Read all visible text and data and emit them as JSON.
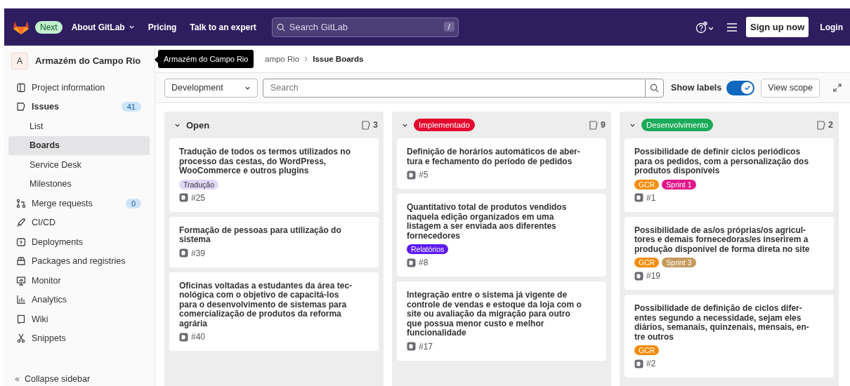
{
  "top_nav": {
    "badge": "Next",
    "links": [
      {
        "label": "About GitLab",
        "dropdown": true
      },
      {
        "label": "Pricing",
        "dropdown": false
      },
      {
        "label": "Talk to an expert",
        "dropdown": false
      }
    ],
    "search": {
      "placeholder": "Search GitLab",
      "shortcut": "/"
    },
    "signup": "Sign up now",
    "login": "Login"
  },
  "sidebar": {
    "project": {
      "avatar": "A",
      "name": "Armazém do Campo Rio"
    },
    "items": [
      {
        "label": "Project information",
        "selected": false
      },
      {
        "label": "Issues",
        "badge": "41",
        "selected": false,
        "children": [
          {
            "label": "List",
            "selected": false
          },
          {
            "label": "Boards",
            "selected": true
          },
          {
            "label": "Service Desk",
            "selected": false
          },
          {
            "label": "Milestones",
            "selected": false
          }
        ]
      },
      {
        "label": "Merge requests",
        "badge": "0",
        "selected": false
      },
      {
        "label": "CI/CD",
        "selected": false
      },
      {
        "label": "Deployments",
        "selected": false
      },
      {
        "label": "Packages and registries",
        "selected": false
      },
      {
        "label": "Monitor",
        "selected": false
      },
      {
        "label": "Analytics",
        "selected": false
      },
      {
        "label": "Wiki",
        "selected": false
      },
      {
        "label": "Snippets",
        "selected": false
      }
    ],
    "collapse": "Collapse sidebar"
  },
  "tooltip": "Armazém do Campo Rio",
  "breadcrumb": [
    "ampo Rio",
    "Issue Boards"
  ],
  "filter_bar": {
    "board": "Development",
    "search": {
      "placeholder": "Search"
    },
    "show_labels": {
      "label": "Show labels",
      "on": true
    },
    "view_scope": "View scope"
  },
  "board": {
    "lists": [
      {
        "title": "Open",
        "kind": "plain",
        "count": "3",
        "cards": [
          {
            "title": "Tradução de todos os termos utilizados no\nprocesso das cestas, do WordPress,\nWooCommerce e outros plugins",
            "labels": [
              {
                "text": "Tradução",
                "color": "#e1d8f9"
              }
            ],
            "number": "#25"
          },
          {
            "title": "Formação de pessoas para utilização do\nsistema",
            "number": "#39"
          },
          {
            "title": "Oficinas voltadas a estudantes da área tec-\nnológica com o objetivo de capacitá-los\npara o desenvolvimento de sistemas para\ncomercialização de produtos da reforma\nagrária",
            "number": "#40"
          }
        ]
      },
      {
        "title": "Implementado",
        "kind": "label",
        "color": "#e5092f",
        "count": "9",
        "cards": [
          {
            "title": "Definição de horários automáticos de aber-\ntura e fechamento do período de pedidos",
            "number": "#5"
          },
          {
            "title": "Quantitativo total de produtos vendidos\nnaquela edição organizados em uma\nlistagem a ser enviada aos diferentes\nfornecedores",
            "labels": [
              {
                "text": "Relatórios",
                "color": "#5c19f5"
              }
            ],
            "number": "#8"
          },
          {
            "title": "Integração entre o sistema já vigente de\ncontrole de vendas e estoque da loja com o\nsite ou avaliação da migração para outro\nque possua menor custo e melhor\nfuncionalidade",
            "number": "#17"
          }
        ]
      },
      {
        "title": "Desenvolvimento",
        "kind": "label",
        "color": "#1bab5a",
        "count": "2",
        "cards": [
          {
            "title": "Possibilidade de definir ciclos periódicos\npara os pedidos, com a personalização dos\nprodutos disponíveis",
            "labels": [
              {
                "text": "GCR",
                "color": "#f28c0c"
              },
              {
                "text": "Sprint 1",
                "color": "#e0178a"
              }
            ],
            "number": "#1"
          },
          {
            "title": "Possibilidade de as/os próprias/os agricul-\ntores e demais fornecedoras/es inserirem a\nprodução disponível de forma direta no site",
            "labels": [
              {
                "text": "GCR",
                "color": "#f28c0c"
              },
              {
                "text": "Sprint 3",
                "color": "#c49a5c"
              }
            ],
            "number": "#19"
          },
          {
            "title": "Possibilidade de definição de ciclos difer-\nentes segundo a necessidade, sejam eles\ndiários, semanais, quinzenais, mensais, en-\ntre outros",
            "labels": [
              {
                "text": "GCR",
                "color": "#f28c0c"
              }
            ],
            "number": "#2"
          }
        ]
      }
    ]
  }
}
